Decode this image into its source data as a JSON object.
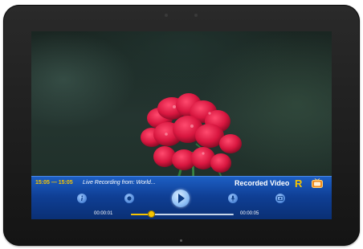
{
  "player": {
    "time_range": "15:05 — 15:05",
    "live_text": "Live Recording from: World...",
    "recorded_label": "Recorded Video",
    "recorded_badge": "R",
    "current_time": "00:00:01",
    "total_time": "00:00:05",
    "progress_fraction": 0.2
  },
  "icons": {
    "info": "info-icon",
    "record": "record-icon",
    "play": "play-icon",
    "mic": "microphone-icon",
    "screenshot": "screenshot-icon",
    "tv": "tv-icon"
  },
  "colors": {
    "accent": "#f6c400",
    "bar_top": "#1d5fc4",
    "bar_bottom": "#0a2f73",
    "flower": "#d8163f"
  }
}
